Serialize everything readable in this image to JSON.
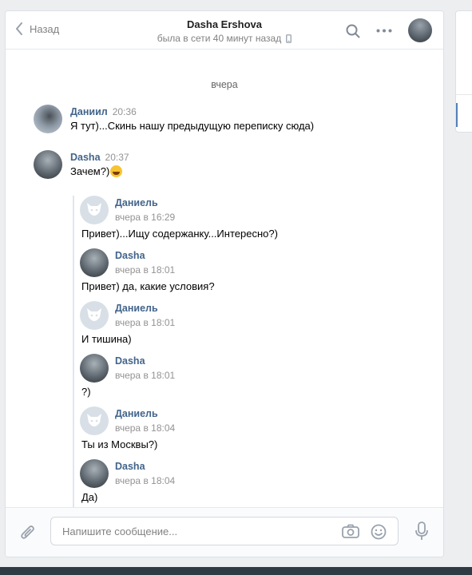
{
  "header": {
    "back_label": "Назад",
    "title": "Dasha Ershova",
    "status": "была в сети 40 минут назад"
  },
  "date_separator": "вчера",
  "messages": [
    {
      "name": "Даниил",
      "time": "20:36",
      "text": "Я тут)...Скинь нашу предыдущую переписку сюда)"
    },
    {
      "name": "Dasha",
      "time": "20:37",
      "text": "Зачем?)",
      "emoji": "grinning-sweat-emoji"
    }
  ],
  "forwarded": [
    {
      "name": "Даниель",
      "time": "вчера в 16:29",
      "text": "Привет)...Ищу содержанку...Интересно?)",
      "avatar": "dog-avatar"
    },
    {
      "name": "Dasha",
      "time": "вчера в 18:01",
      "text": "Привет) да, какие условия?",
      "avatar": "photo-avatar"
    },
    {
      "name": "Даниель",
      "time": "вчера в 18:01",
      "text": "И тишина)",
      "avatar": "dog-avatar"
    },
    {
      "name": "Dasha",
      "time": "вчера в 18:01",
      "text": "?)",
      "avatar": "photo-avatar"
    },
    {
      "name": "Даниель",
      "time": "вчера в 18:04",
      "text": "Ты из Москвы?)",
      "avatar": "dog-avatar"
    },
    {
      "name": "Dasha",
      "time": "вчера в 18:04",
      "text": "Да)",
      "avatar": "photo-avatar"
    }
  ],
  "composer": {
    "placeholder": "Напишите сообщение..."
  },
  "colors": {
    "link_blue": "#42648b",
    "accent": "#5181b8",
    "page_bg": "#edeef0"
  }
}
